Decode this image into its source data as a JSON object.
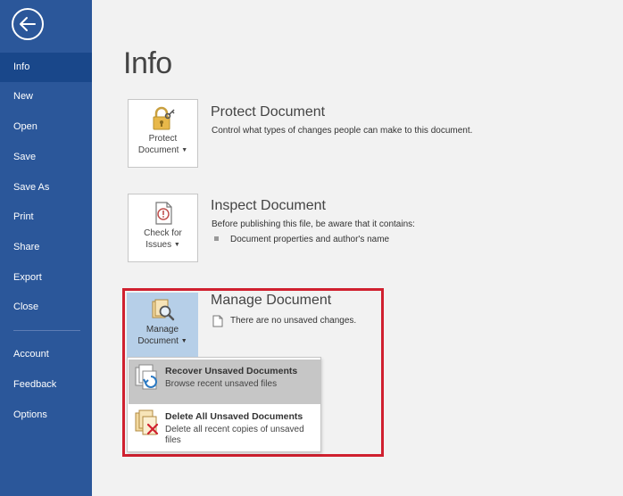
{
  "sidebar": {
    "back_label": "",
    "items": [
      {
        "label": "Info",
        "active": true
      },
      {
        "label": "New"
      },
      {
        "label": "Open"
      },
      {
        "label": "Save"
      },
      {
        "label": "Save As"
      },
      {
        "label": "Print"
      },
      {
        "label": "Share"
      },
      {
        "label": "Export"
      },
      {
        "label": "Close"
      },
      {
        "label": "Account"
      },
      {
        "label": "Feedback"
      },
      {
        "label": "Options"
      }
    ]
  },
  "page": {
    "title": "Info"
  },
  "protect": {
    "button_line1": "Protect",
    "button_line2": "Document",
    "title": "Protect Document",
    "description": "Control what types of changes people can make to this document."
  },
  "inspect": {
    "button_line1": "Check for",
    "button_line2": "Issues",
    "title": "Inspect Document",
    "description": "Before publishing this file, be aware that it contains:",
    "bullets": [
      "Document properties and author's name"
    ]
  },
  "manage": {
    "button_line1": "Manage",
    "button_line2": "Document",
    "title": "Manage Document",
    "status": "There are no unsaved changes."
  },
  "dropdown": {
    "items": [
      {
        "title": "Recover Unsaved Documents",
        "description": "Browse recent unsaved files"
      },
      {
        "title": "Delete All Unsaved Documents",
        "description": "Delete all recent copies of unsaved files"
      }
    ]
  },
  "colors": {
    "sidebar": "#2b579a",
    "sidebar_active": "#19478a",
    "highlight_border": "#d0202f",
    "manage_tile": "#b6cfe8",
    "dropdown_hover": "#c6c6c6"
  },
  "icons": {
    "back": "back-arrow-icon",
    "protect": "lock-key-icon",
    "inspect": "document-check-icon",
    "manage": "document-magnifier-icon",
    "recover": "document-recover-icon",
    "delete": "document-delete-icon",
    "status": "document-small-icon"
  }
}
